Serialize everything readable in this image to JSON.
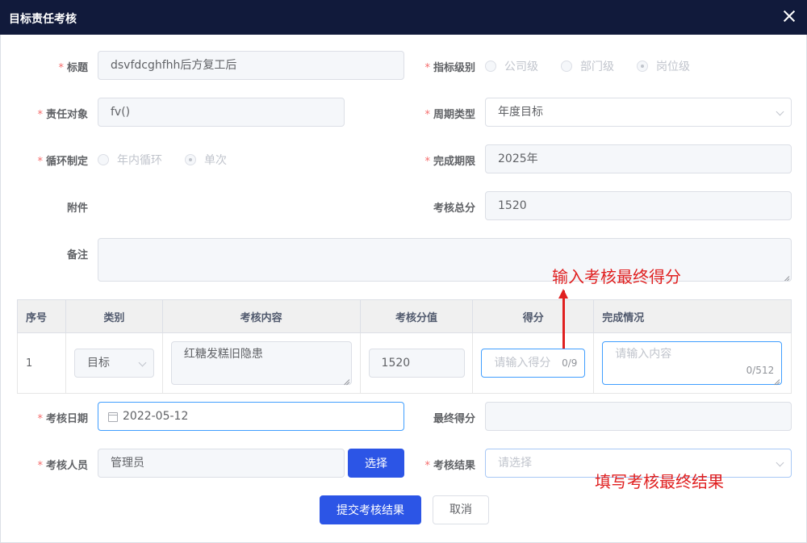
{
  "dialog": {
    "title": "目标责任考核"
  },
  "form": {
    "title_label": "标题",
    "title_value": "dsvfdcghfhh后方复工后",
    "level_label": "指标级别",
    "level_options": [
      "公司级",
      "部门级",
      "岗位级"
    ],
    "level_selected": "岗位级",
    "target_label": "责任对象",
    "target_value": "fv()",
    "period_label": "周期类型",
    "period_value": "年度目标",
    "cycle_label": "循环制定",
    "cycle_options": [
      "年内循环",
      "单次"
    ],
    "cycle_selected": "单次",
    "deadline_label": "完成期限",
    "deadline_value": "2025年",
    "attachment_label": "附件",
    "total_label": "考核总分",
    "total_value": "1520",
    "remark_label": "备注",
    "remark_value": "",
    "date_label": "考核日期",
    "date_value": "2022-05-12",
    "final_score_label": "最终得分",
    "final_score_value": "",
    "assessor_label": "考核人员",
    "assessor_value": "管理员",
    "select_button": "选择",
    "result_label": "考核结果",
    "result_placeholder": "请选择"
  },
  "table": {
    "headers": [
      "序号",
      "类别",
      "考核内容",
      "考核分值",
      "得分",
      "完成情况"
    ],
    "rows": [
      {
        "index": "1",
        "category": "目标",
        "content": "红糖发糕旧隐患",
        "points": "1520",
        "score_placeholder": "请输入得分",
        "score_counter": "0/9",
        "status_placeholder": "请输入内容",
        "status_counter": "0/512"
      }
    ]
  },
  "actions": {
    "submit": "提交考核结果",
    "cancel": "取消"
  },
  "annotations": {
    "score_hint": "输入考核最终得分",
    "result_hint": "填写考核最终结果"
  },
  "colors": {
    "titlebar": "#111a3b",
    "primary": "#2c55e6",
    "required": "#f56c6c",
    "annotation": "#e02020",
    "focus_border": "#409eff"
  }
}
